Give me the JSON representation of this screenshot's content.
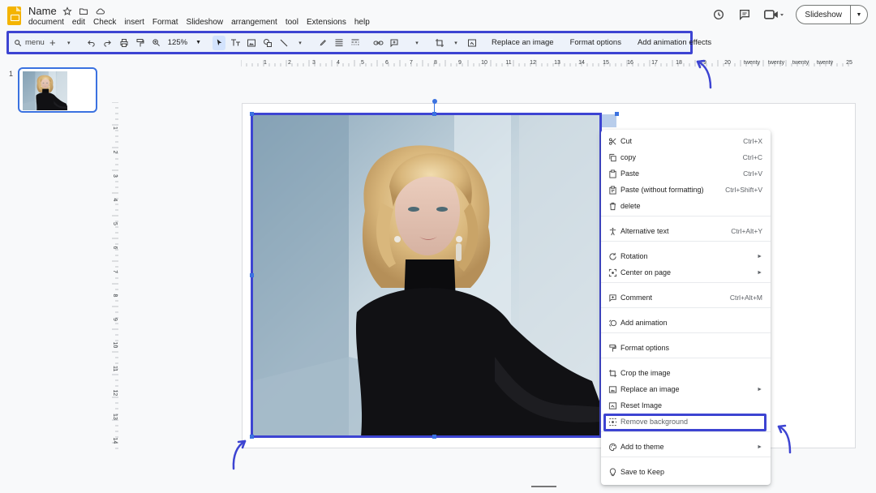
{
  "header": {
    "doc_title": "Name",
    "menu": [
      "document",
      "edit",
      "Check",
      "insert",
      "Format",
      "Slideshow",
      "arrangement",
      "tool",
      "Extensions",
      "help"
    ],
    "slideshow_label": "Slideshow"
  },
  "toolbar": {
    "search_label": "menu",
    "zoom": "125%",
    "replace_image": "Replace an image",
    "format_options": "Format options",
    "animation": "Add animation effects"
  },
  "ruler": {
    "top_labels": [
      "1",
      "2",
      "3",
      "4",
      "5",
      "6",
      "7",
      "8",
      "9",
      "10",
      "11",
      "12",
      "13",
      "14",
      "15",
      "16",
      "17",
      "18",
      "19",
      "20",
      "twenty",
      "twenty",
      "twenty",
      "twenty",
      "25"
    ],
    "left_labels": [
      "1",
      "2",
      "3",
      "4",
      "5",
      "6",
      "7",
      "8",
      "9",
      "10",
      "11",
      "12",
      "13",
      "14"
    ]
  },
  "slides_panel": {
    "slide_number": "1"
  },
  "context_menu": {
    "items": [
      {
        "label": "Cut",
        "shortcut": "Ctrl+X",
        "icon": "scissors-icon"
      },
      {
        "label": "copy",
        "shortcut": "Ctrl+C",
        "icon": "copy-icon"
      },
      {
        "label": "Paste",
        "shortcut": "Ctrl+V",
        "icon": "paste-icon"
      },
      {
        "label": "Paste (without formatting)",
        "shortcut": "Ctrl+Shift+V",
        "icon": "paste-plain-icon"
      },
      {
        "label": "delete",
        "shortcut": "",
        "icon": "trash-icon"
      },
      {
        "label": "Alternative text",
        "shortcut": "Ctrl+Alt+Y",
        "icon": "accessibility-icon"
      },
      {
        "label": "Rotation",
        "shortcut": "",
        "icon": "rotate-icon",
        "submenu": true
      },
      {
        "label": "Center on page",
        "shortcut": "",
        "icon": "center-icon",
        "submenu": true
      },
      {
        "label": "Comment",
        "shortcut": "Ctrl+Alt+M",
        "icon": "comment-icon"
      },
      {
        "label": "Add animation",
        "shortcut": "",
        "icon": "animation-icon"
      },
      {
        "label": "Format options",
        "shortcut": "",
        "icon": "format-icon"
      },
      {
        "label": "Crop the image",
        "shortcut": "",
        "icon": "crop-icon"
      },
      {
        "label": "Replace an image",
        "shortcut": "",
        "icon": "replace-image-icon",
        "submenu": true
      },
      {
        "label": "Reset Image",
        "shortcut": "",
        "icon": "reset-image-icon"
      },
      {
        "label": "Remove background",
        "shortcut": "",
        "icon": "remove-background-icon",
        "disabled": true
      },
      {
        "label": "Add to theme",
        "shortcut": "",
        "icon": "palette-icon",
        "submenu": true
      },
      {
        "label": "Save to Keep",
        "shortcut": "",
        "icon": "keep-icon"
      }
    ]
  },
  "colors": {
    "highlight": "#3d44d2",
    "toolbar_bg": "#edf2fa",
    "selection": "#3b72e0"
  }
}
